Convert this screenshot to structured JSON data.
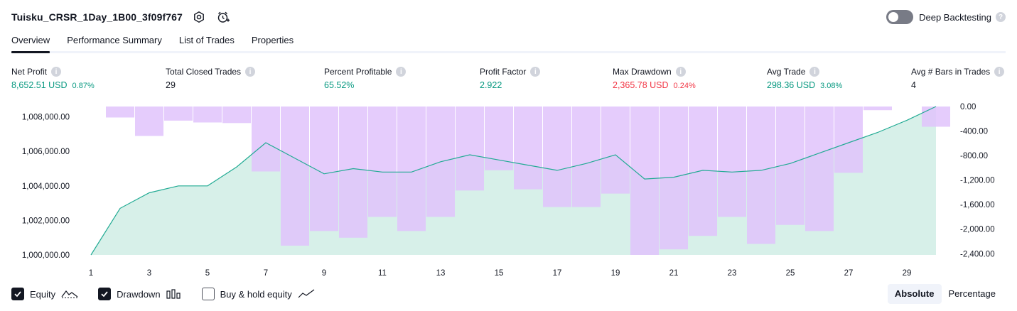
{
  "header": {
    "title": "Tuisku_CRSR_1Day_1B00_3f09f767",
    "settings_icon": "settings-gear-icon",
    "alert_icon": "add-alert-clock-icon"
  },
  "deep_backtesting": {
    "label": "Deep Backtesting",
    "enabled": false,
    "help": "?"
  },
  "tabs": [
    {
      "label": "Overview",
      "active": true
    },
    {
      "label": "Performance Summary",
      "active": false
    },
    {
      "label": "List of Trades",
      "active": false
    },
    {
      "label": "Properties",
      "active": false
    }
  ],
  "stats": [
    {
      "label": "Net Profit",
      "value": "8,652.51 USD",
      "pct": "0.87%",
      "color": "green"
    },
    {
      "label": "Total Closed Trades",
      "value": "29",
      "pct": "",
      "color": "neutral"
    },
    {
      "label": "Percent Profitable",
      "value": "65.52%",
      "pct": "",
      "color": "green"
    },
    {
      "label": "Profit Factor",
      "value": "2.922",
      "pct": "",
      "color": "green"
    },
    {
      "label": "Max Drawdown",
      "value": "2,365.78 USD",
      "pct": "0.24%",
      "color": "red"
    },
    {
      "label": "Avg Trade",
      "value": "298.36 USD",
      "pct": "3.08%",
      "color": "green"
    },
    {
      "label": "Avg # Bars in Trades",
      "value": "4",
      "pct": "",
      "color": "neutral"
    }
  ],
  "info_glyph": "i",
  "colors": {
    "equity_line": "#22ab94",
    "equity_fill": "#d7f0e9",
    "drawdown_fill": "#e0c3fc",
    "drawdown_overlap": "#bdb6ec",
    "green": "#089981",
    "red": "#f23645"
  },
  "chart_data": {
    "type": "area",
    "x_ticks": [
      "1",
      "3",
      "5",
      "7",
      "9",
      "11",
      "13",
      "15",
      "17",
      "19",
      "21",
      "23",
      "25",
      "27",
      "29"
    ],
    "left_axis": {
      "ticks": [
        "1,008,000.00",
        "1,006,000.00",
        "1,004,000.00",
        "1,002,000.00",
        "1,000,000.00"
      ],
      "tick_values": [
        1008000,
        1006000,
        1004000,
        1002000,
        1000000
      ],
      "range": [
        1000000,
        1008600
      ]
    },
    "right_axis": {
      "ticks": [
        "0.00",
        "-400.00",
        "-800.00",
        "-1,200.00",
        "-1,600.00",
        "-2,000.00",
        "-2,400.00"
      ],
      "tick_values": [
        0,
        -400,
        -800,
        -1200,
        -1600,
        -2000,
        -2400
      ],
      "range": [
        0,
        -2420
      ]
    },
    "series": [
      {
        "name": "Equity",
        "x": [
          1,
          2,
          3,
          4,
          5,
          6,
          7,
          8,
          9,
          10,
          11,
          12,
          13,
          14,
          15,
          16,
          17,
          18,
          19,
          20,
          21,
          22,
          23,
          24,
          25,
          26,
          27,
          28,
          29,
          30
        ],
        "values": [
          1000000,
          1002700,
          1003600,
          1004000,
          1004000,
          1005100,
          1006500,
          1005600,
          1004700,
          1005000,
          1004800,
          1004800,
          1005400,
          1005800,
          1005500,
          1005200,
          1004900,
          1005300,
          1005800,
          1004400,
          1004500,
          1004900,
          1004800,
          1004900,
          1005300,
          1005900,
          1006500,
          1007100,
          1007800,
          1008600
        ]
      },
      {
        "name": "Drawdown",
        "x": [
          1,
          2,
          3,
          4,
          5,
          6,
          7,
          8,
          9,
          10,
          11,
          12,
          13,
          14,
          15,
          16,
          17,
          18,
          19,
          20,
          21,
          22,
          23,
          24,
          25,
          26,
          27,
          28,
          29,
          30
        ],
        "values": [
          0,
          -180,
          -480,
          -230,
          -260,
          -270,
          -1060,
          -2270,
          -2030,
          -2140,
          -1800,
          -2030,
          -1800,
          -1370,
          -1040,
          -1350,
          -1640,
          -1640,
          -1420,
          -2420,
          -2330,
          -2110,
          -1800,
          -2240,
          -1930,
          -2030,
          -1080,
          -60,
          0,
          -330
        ]
      }
    ],
    "legend": [
      {
        "label": "Equity",
        "checked": true,
        "icon": "equity-line-icon"
      },
      {
        "label": "Drawdown",
        "checked": true,
        "icon": "drawdown-bars-icon"
      },
      {
        "label": "Buy & hold equity",
        "checked": false,
        "icon": "buy-hold-line-icon"
      }
    ],
    "modes": [
      {
        "label": "Absolute",
        "active": true
      },
      {
        "label": "Percentage",
        "active": false
      }
    ]
  }
}
